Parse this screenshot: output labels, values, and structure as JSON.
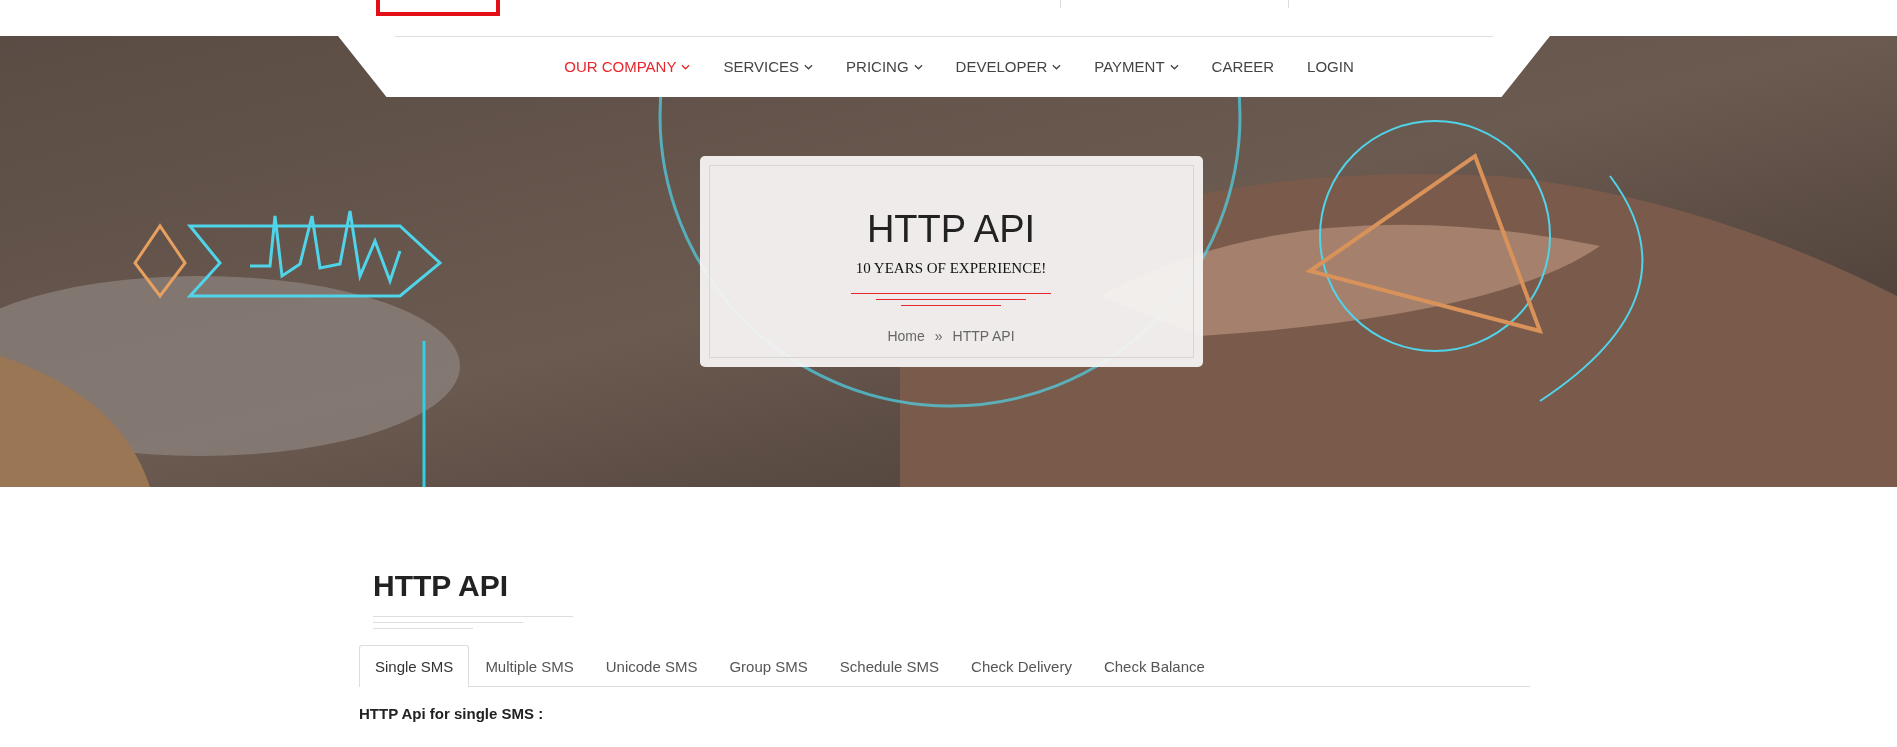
{
  "nav": [
    {
      "label": "OUR COMPANY",
      "caret": true,
      "selected": true
    },
    {
      "label": "SERVICES",
      "caret": true,
      "selected": false
    },
    {
      "label": "PRICING",
      "caret": true,
      "selected": false
    },
    {
      "label": "DEVELOPER",
      "caret": true,
      "selected": false
    },
    {
      "label": "PAYMENT",
      "caret": true,
      "selected": false
    },
    {
      "label": "CAREER",
      "caret": false,
      "selected": false
    },
    {
      "label": "LOGIN",
      "caret": false,
      "selected": false
    }
  ],
  "hero": {
    "title": "HTTP API",
    "subtitle": "10 YEARS OF EXPERIENCE!",
    "breadcrumb": [
      "Home",
      "HTTP API"
    ],
    "separator": "»"
  },
  "section": {
    "title": "HTTP API"
  },
  "tabs": [
    {
      "label": "Single SMS",
      "selected": true
    },
    {
      "label": "Multiple SMS",
      "selected": false
    },
    {
      "label": "Unicode SMS",
      "selected": false
    },
    {
      "label": "Group SMS",
      "selected": false
    },
    {
      "label": "Schedule SMS",
      "selected": false
    },
    {
      "label": "Check Delivery",
      "selected": false
    },
    {
      "label": "Check Balance",
      "selected": false
    }
  ],
  "content": {
    "heading": "HTTP Api for single SMS :"
  }
}
